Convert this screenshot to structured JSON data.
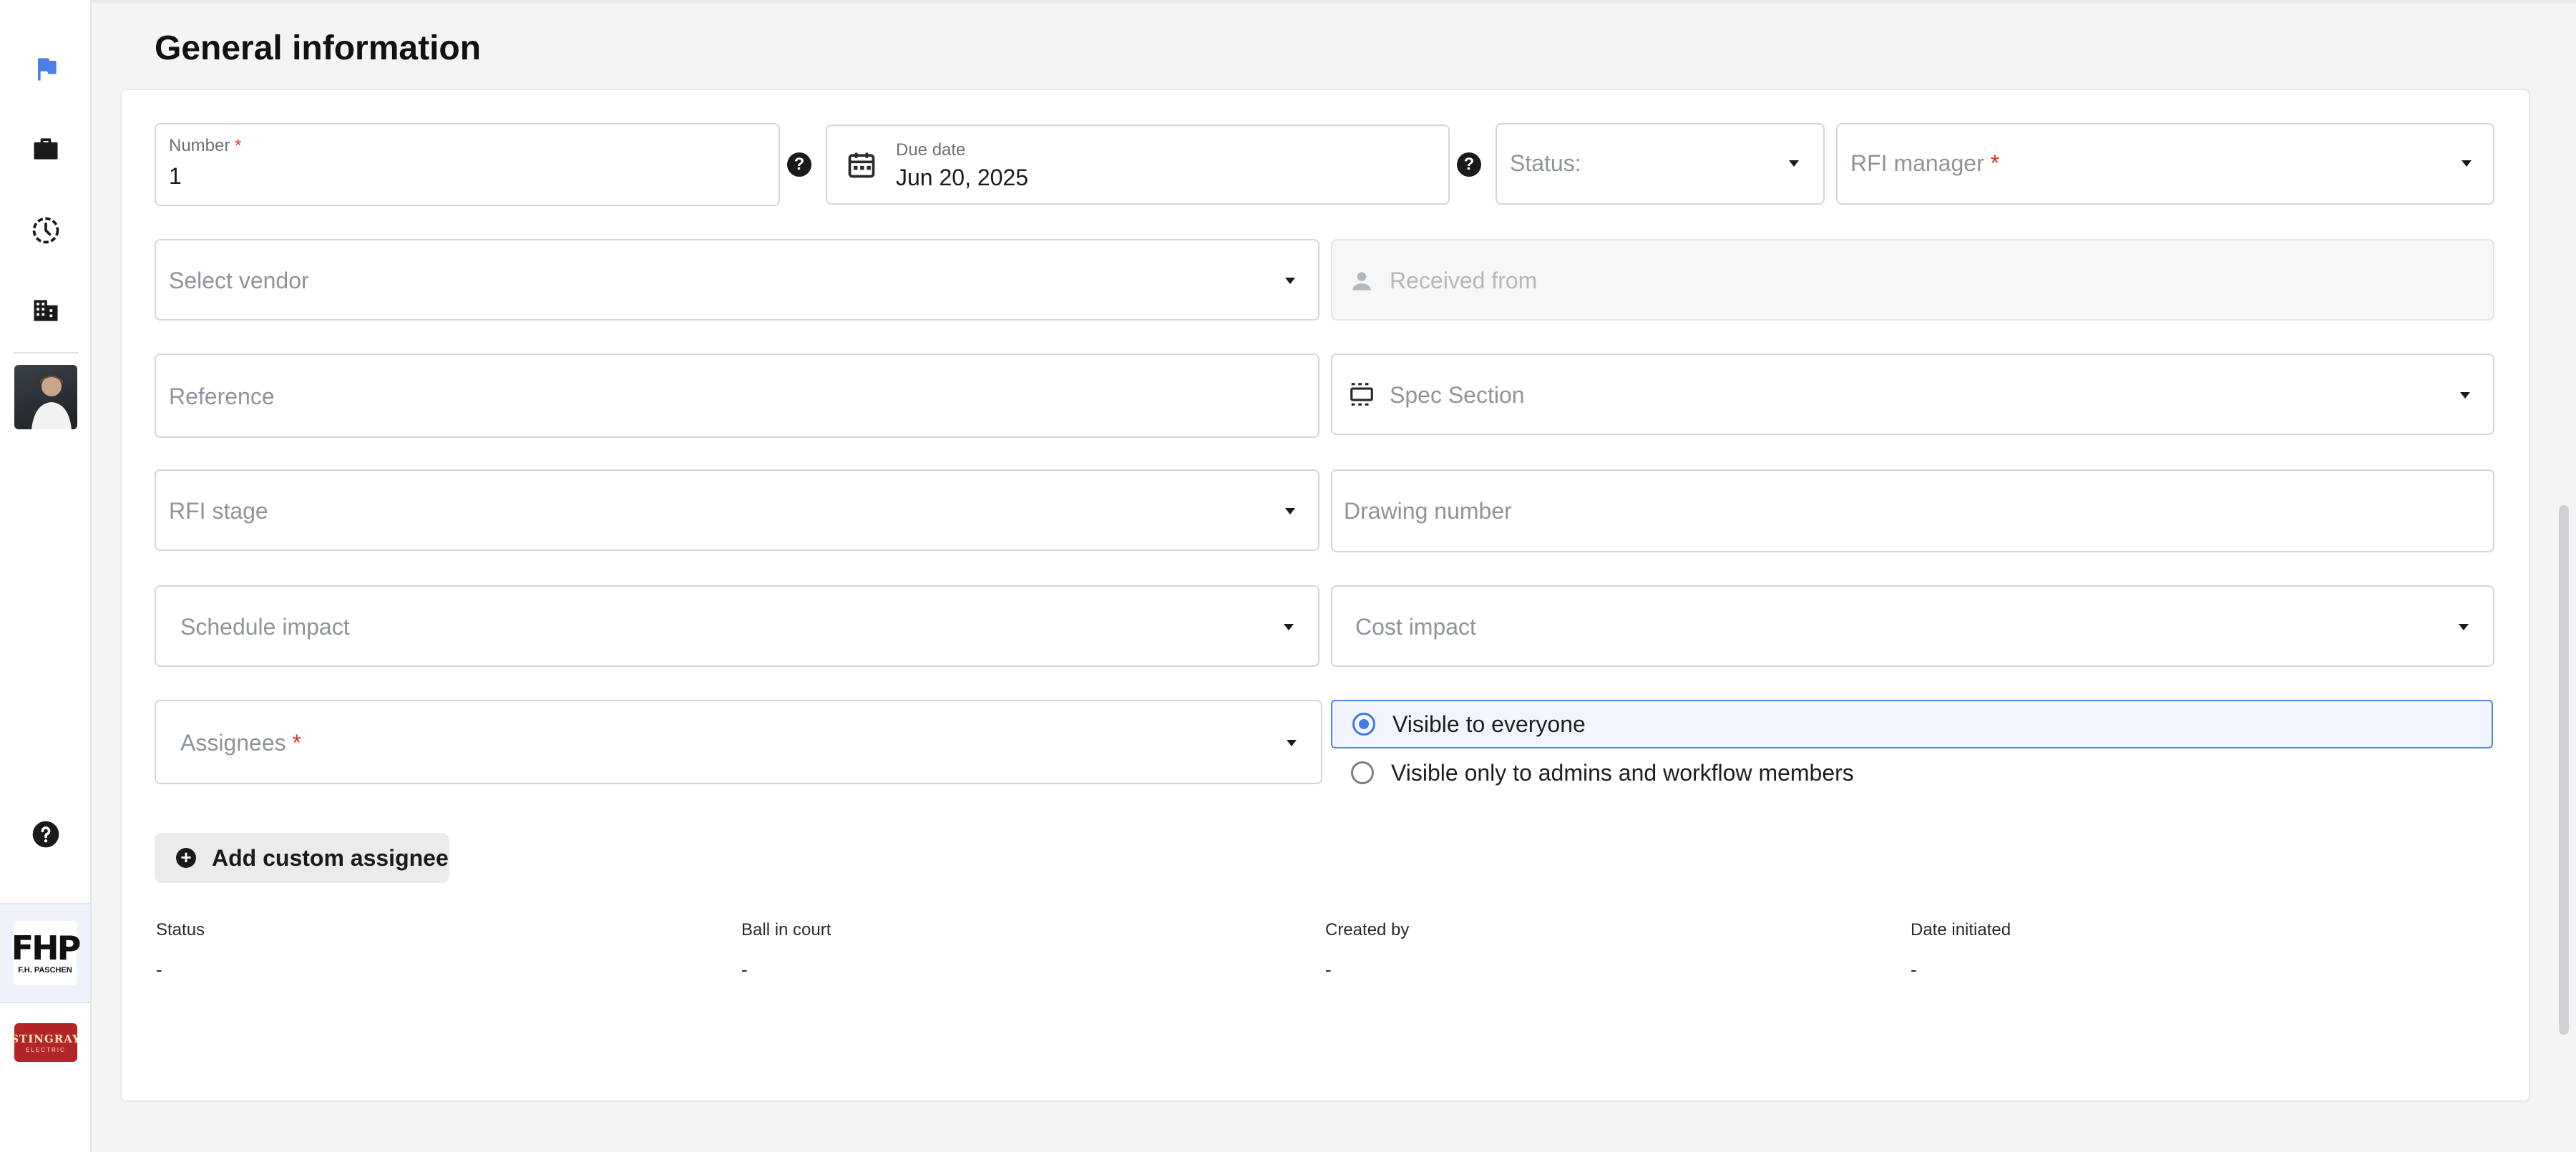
{
  "page_title": "General information",
  "fields": {
    "number": {
      "label": "Number",
      "value": "1"
    },
    "due_date": {
      "label": "Due date",
      "value": "Jun 20, 2025"
    },
    "status": {
      "placeholder": "Status:"
    },
    "rfi_manager": {
      "placeholder": "RFI manager"
    },
    "vendor": {
      "placeholder": "Select vendor"
    },
    "received_from": {
      "placeholder": "Received from"
    },
    "reference": {
      "placeholder": "Reference"
    },
    "spec_section": {
      "placeholder": "Spec Section"
    },
    "rfi_stage": {
      "placeholder": "RFI stage"
    },
    "drawing_number": {
      "placeholder": "Drawing number"
    },
    "schedule_impact": {
      "placeholder": "Schedule impact"
    },
    "cost_impact": {
      "placeholder": "Cost impact"
    },
    "assignees": {
      "placeholder": "Assignees"
    }
  },
  "required_mark": "*",
  "help_glyph": "?",
  "visibility": {
    "options": [
      {
        "label": "Visible to everyone",
        "selected": true
      },
      {
        "label": "Visible only to admins and workflow members",
        "selected": false
      }
    ]
  },
  "add_custom_assignee": {
    "label": "Add custom assignee",
    "glyph": "+"
  },
  "meta": [
    {
      "label": "Status",
      "value": "-"
    },
    {
      "label": "Ball in court",
      "value": "-"
    },
    {
      "label": "Created by",
      "value": "-"
    },
    {
      "label": "Date initiated",
      "value": "-"
    }
  ],
  "companies": {
    "primary": {
      "mark": "FHP",
      "name": "F.H. PASCHEN"
    },
    "secondary": {
      "mark": "STINGRAY",
      "sub": "ELECTRIC"
    }
  },
  "icons": {
    "sidebar": [
      "flag-icon",
      "briefcase-icon",
      "history-icon",
      "building-icon",
      "help-icon"
    ],
    "due_date": "calendar-icon",
    "received_from": "person-icon",
    "spec_section": "spec-section-icon"
  },
  "colors": {
    "accent": "#3f7be0",
    "required": "#d93025",
    "flag": "#4a7ee8"
  }
}
